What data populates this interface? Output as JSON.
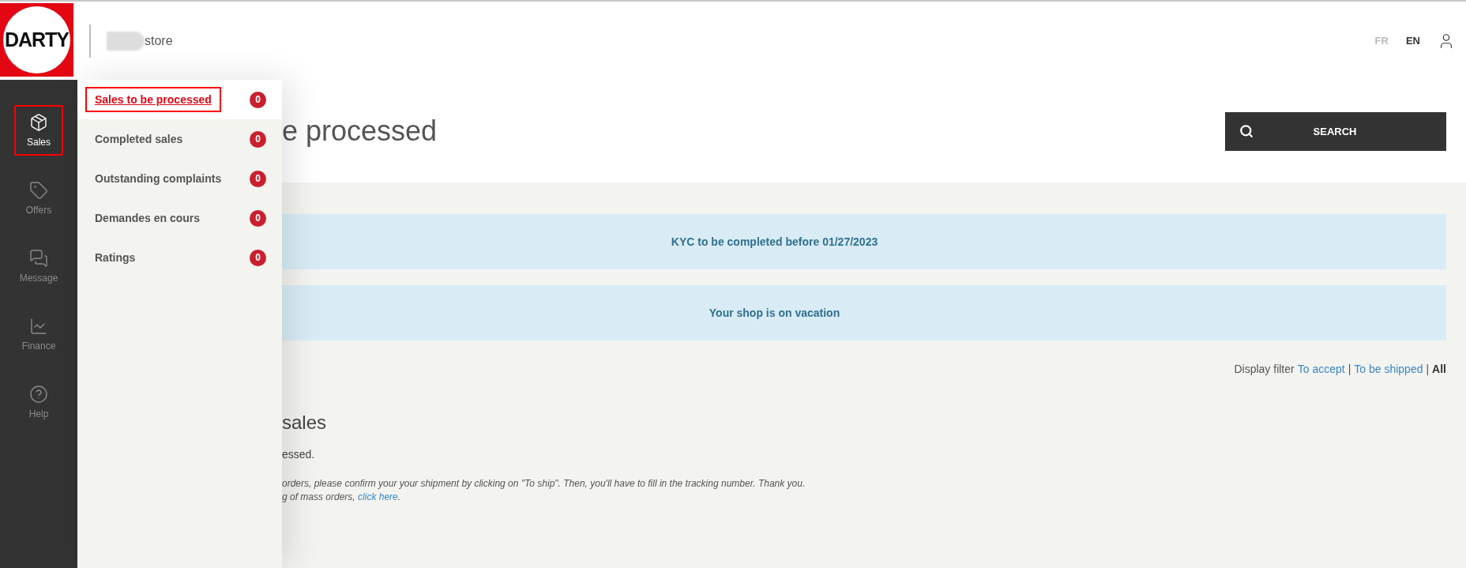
{
  "header": {
    "logo": "DARTY",
    "shop_name": "store",
    "languages": [
      {
        "label": "FR",
        "selected": false
      },
      {
        "label": "EN",
        "selected": true
      }
    ]
  },
  "sidebar": {
    "items": [
      {
        "label": "Sales",
        "selected": true
      },
      {
        "label": "Offers",
        "selected": false
      },
      {
        "label": "Message",
        "selected": false
      },
      {
        "label": "Finance",
        "selected": false
      },
      {
        "label": "Help",
        "selected": false
      }
    ]
  },
  "submenu": {
    "items": [
      {
        "label": "Sales to be processed",
        "count": "0",
        "selected": true
      },
      {
        "label": "Completed sales",
        "count": "0",
        "selected": false
      },
      {
        "label": "Outstanding complaints",
        "count": "0",
        "selected": false
      },
      {
        "label": "Demandes en cours",
        "count": "0",
        "selected": false
      },
      {
        "label": "Ratings",
        "count": "0",
        "selected": false
      }
    ]
  },
  "page": {
    "title": "e processed",
    "search_button": "SEARCH"
  },
  "banners": [
    "KYC to be completed before 01/27/2023",
    "Your shop is on vacation"
  ],
  "filter": {
    "label": "Display filter",
    "separator": "|",
    "options": [
      {
        "label": "To accept",
        "selected": false
      },
      {
        "label": "To be shipped",
        "selected": false
      },
      {
        "label": "All",
        "selected": true
      }
    ]
  },
  "section": {
    "heading": "sales",
    "message": "essed.",
    "notes": [
      {
        "text": "orders, please confirm your your shipment by clicking on \"To ship\". Then, you'll have to fill in the tracking number. Thank you."
      },
      {
        "text": "g of mass orders, ",
        "link": "click here",
        "after": "."
      }
    ]
  }
}
